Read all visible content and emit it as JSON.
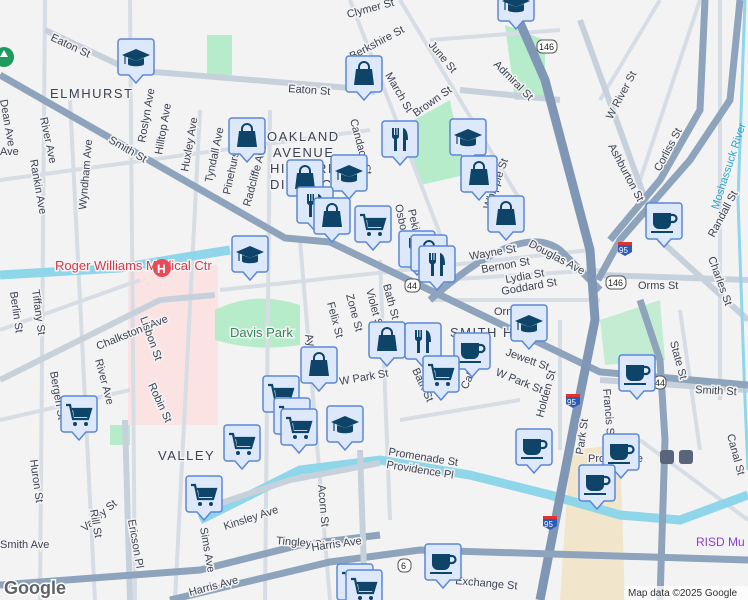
{
  "map": {
    "neighborhoods": [
      "ELMHURST",
      "OAKLAND",
      "AVENUE",
      "HISTORIC",
      "DISTRICT",
      "VALLEY",
      "SMITH HILL"
    ],
    "streets": [
      "Eaton St",
      "Eaton St",
      "Smith St",
      "Smith St",
      "Roslyn Ave",
      "Hilltop Ave",
      "Huxley Ave",
      "Tyndall Ave",
      "Pinehurst",
      "Radcliffe Ave",
      "River Ave",
      "Rankin Ave",
      "Wyndham Ave",
      "Clymer St",
      "Berkshire St",
      "June St",
      "March St",
      "Admiral St",
      "Brown St",
      "Candace St",
      "Osborn St",
      "Pekin St",
      "Whipple St",
      "Douglas Ave",
      "Wayne St",
      "Bernon St",
      "Lydia St",
      "Goddard St",
      "Orms St",
      "Orms St",
      "W River St",
      "Ashburton St",
      "Corliss St",
      "Randall St",
      "Charles St",
      "Chalkstone Ave",
      "Lisbon St",
      "Robin St",
      "River Ave",
      "Ayrault St",
      "Felix St",
      "Zone St",
      "Violet St",
      "Bath St",
      "Bath St",
      "Calverly St",
      "Jewett St",
      "W Park St",
      "W Park St",
      "Holden St",
      "Park St",
      "Francis St",
      "State St",
      "Canal St",
      "Promenade St",
      "Providence Pl",
      "Kinsley Ave",
      "Acorn St",
      "Tingley St",
      "Harris Ave",
      "Harris Ave",
      "Exchange St",
      "Valley St",
      "Sims Ave",
      "Rill St",
      "Ericson Pl",
      "Huron St",
      "Bergen St",
      "Berlin St",
      "Tiffany St",
      "Smith Ave",
      "Ave",
      "Dean Ave"
    ],
    "water": [
      "Moshassuck River"
    ],
    "pois": {
      "hospital": "Roger Williams Medical Ctr",
      "park": "Davis Park",
      "station": "Providence",
      "museum": "RISD Mu"
    },
    "shields": {
      "route146": "146",
      "route44": "44",
      "i95": "95",
      "route6": "6"
    },
    "markers": [
      "#m-grad",
      "#m-shop",
      "#m-grad",
      "#m-shop",
      "#m-food",
      "#m-grad",
      "#m-shop",
      "#m-shop",
      "#m-coffee",
      "#m-shop",
      "#m-grad",
      "#m-food",
      "#m-shop",
      "#m-cart",
      "#m-grad",
      "#m-food",
      "#m-shop",
      "#m-food",
      "#m-grad",
      "#m-shop",
      "#m-food",
      "#m-coffee",
      "#m-cart",
      "#m-coffee",
      "#m-shop",
      "#m-cart",
      "#m-cart",
      "#m-cart",
      "#m-grad",
      "#m-cart",
      "#m-cart",
      "#m-cart",
      "#m-coffee",
      "#m-coffee",
      "#m-coffee",
      "#m-coffee",
      "#m-cart",
      "#m-cart"
    ],
    "attribution": "Map data ©2025 Google",
    "logo": "Google"
  },
  "colors": {
    "marker_fill": "#dde8fb",
    "marker_stroke": "#5b87d6",
    "icon": "#0d4468",
    "park": "#b6ecc9",
    "hospital": "#fbe3e3",
    "river": "#8fd6ea"
  }
}
